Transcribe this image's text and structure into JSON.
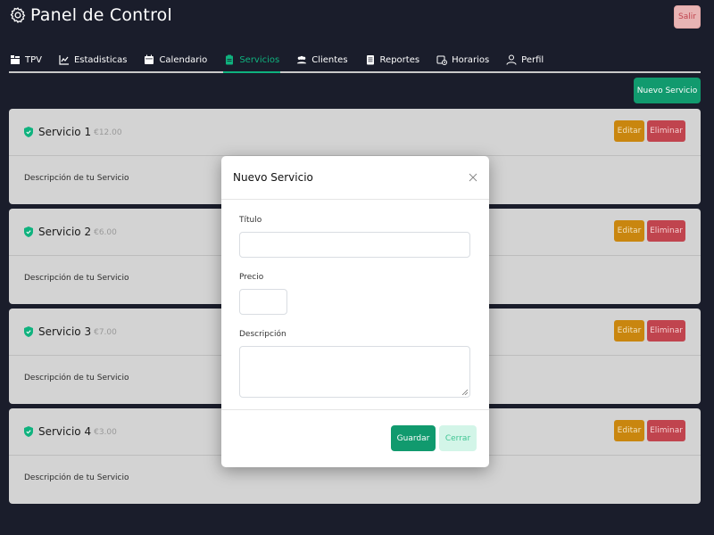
{
  "app": {
    "title": "Panel de Control",
    "logout_label": "Salir"
  },
  "tabs": [
    {
      "label": "TPV",
      "icon": "pos-icon"
    },
    {
      "label": "Estadisticas",
      "icon": "chart-icon"
    },
    {
      "label": "Calendario",
      "icon": "calendar-icon"
    },
    {
      "label": "Servicios",
      "icon": "clipboard-icon",
      "active": true
    },
    {
      "label": "Clientes",
      "icon": "users-icon"
    },
    {
      "label": "Reportes",
      "icon": "report-icon"
    },
    {
      "label": "Horarios",
      "icon": "schedule-icon"
    },
    {
      "label": "Perfil",
      "icon": "user-icon"
    }
  ],
  "new_service_label": "Nuevo Servicio",
  "services": [
    {
      "name": "Servicio 1",
      "price": "€12.00",
      "description": "Descripción de tu Servicio",
      "edit_label": "Editar",
      "delete_label": "Eliminar"
    },
    {
      "name": "Servicio 2",
      "price": "€6.00",
      "description": "Descripción de tu Servicio",
      "edit_label": "Editar",
      "delete_label": "Eliminar"
    },
    {
      "name": "Servicio 3",
      "price": "€7.00",
      "description": "Descripción de tu Servicio",
      "edit_label": "Editar",
      "delete_label": "Eliminar"
    },
    {
      "name": "Servicio 4",
      "price": "€3.00",
      "description": "Descripción de tu Servicio",
      "edit_label": "Editar",
      "delete_label": "Eliminar"
    }
  ],
  "modal": {
    "title": "Nuevo Servicio",
    "fields": {
      "title_label": "Título",
      "title_value": "",
      "price_label": "Precio",
      "price_value": "",
      "description_label": "Descripción",
      "description_value": ""
    },
    "save_label": "Guardar",
    "close_label": "Cerrar"
  },
  "colors": {
    "background": "#1a1d2b",
    "accent": "#0fb27e",
    "primary_button": "#119a6e",
    "edit_button": "#c9860f",
    "delete_button": "#c0444e",
    "card_background": "#d3d3d3"
  }
}
